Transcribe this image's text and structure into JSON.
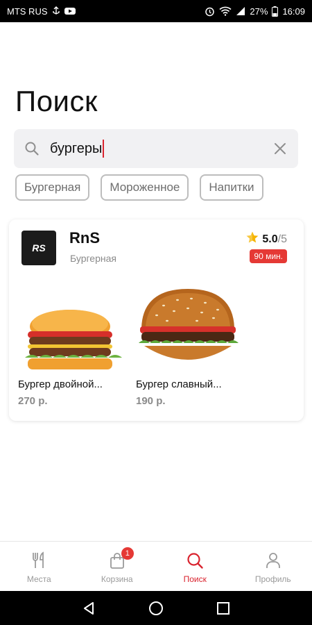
{
  "status_bar": {
    "carrier": "MTS RUS",
    "battery": "27%",
    "time": "16:09"
  },
  "page": {
    "title": "Поиск"
  },
  "search": {
    "value": "бургеры",
    "icon": "search-icon",
    "clear_icon": "close-icon"
  },
  "chips": [
    {
      "label": "Бургерная"
    },
    {
      "label": "Мороженное"
    },
    {
      "label": "Напитки"
    }
  ],
  "restaurant": {
    "logo_text": "RS",
    "name": "RnS",
    "category": "Бургерная",
    "rating": "5.0",
    "rating_max": "/5",
    "delivery_time": "90 мин.",
    "items": [
      {
        "name": "Бургер двойной...",
        "price": "270 р."
      },
      {
        "name": "Бургер славный...",
        "price": "190 р."
      }
    ]
  },
  "bottom_nav": {
    "items": [
      {
        "label": "Места",
        "icon": "fork-knife-icon"
      },
      {
        "label": "Корзина",
        "icon": "cart-bag-icon",
        "badge": "1"
      },
      {
        "label": "Поиск",
        "icon": "search-icon",
        "active": true
      },
      {
        "label": "Профиль",
        "icon": "profile-icon"
      }
    ]
  },
  "colors": {
    "accent": "#d9232e",
    "badge": "#e53935",
    "chip_border": "#bdbdbd"
  }
}
